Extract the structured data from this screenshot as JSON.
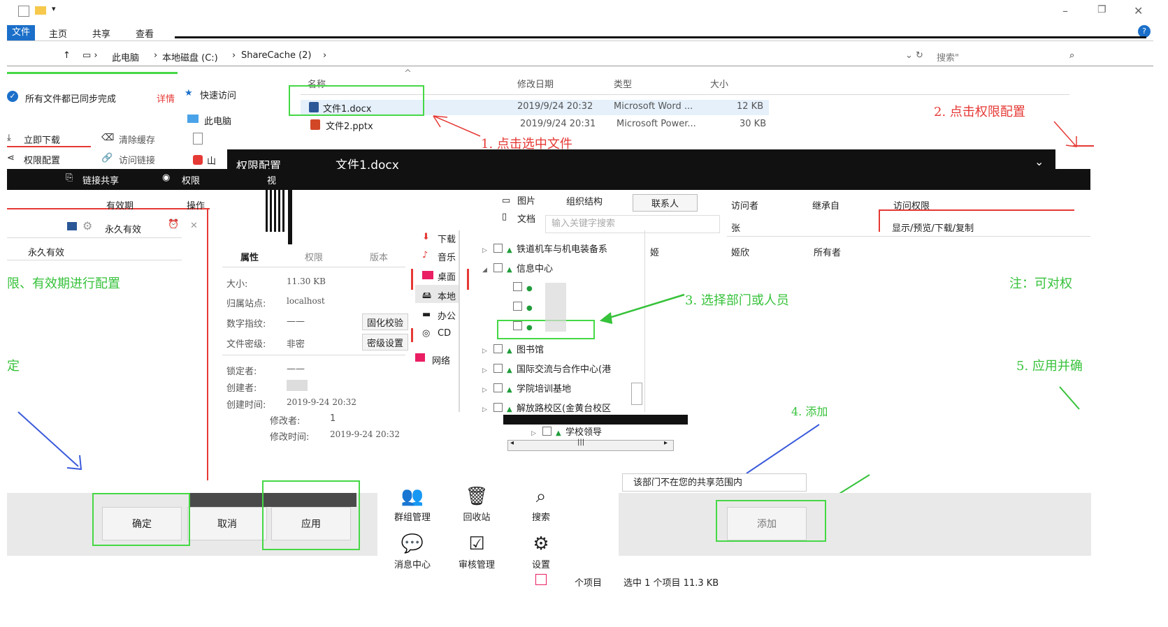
{
  "quick_access": {
    "icons": [
      "checkbox-icon",
      "folder-icon",
      "dropdown-arrow-icon"
    ]
  },
  "window_controls": {
    "minimize": "–",
    "restore": "❐",
    "close": "✕"
  },
  "ribbon": {
    "tabs": [
      "文件",
      "主页",
      "共享",
      "查看"
    ],
    "active_tab": "文件"
  },
  "address": {
    "path": [
      "此电脑",
      "本地磁盘 (C:)",
      "ShareCache (2)"
    ],
    "search_placeholder": "搜索\""
  },
  "sync": {
    "status": "所有文件都已同步完成",
    "details_link": "详情"
  },
  "actions": {
    "download": "立即下载",
    "clear_cache": "清除缓存",
    "permission_config": "权限配置",
    "access_link": "访问链接",
    "link_share": "链接共享",
    "permission_label": "权限",
    "view": "视"
  },
  "nav": {
    "quick_access": "快速访问",
    "this_pc": "此电脑",
    "shan": "山",
    "pictures": "图片",
    "documents": "文档"
  },
  "file_list": {
    "columns": [
      "名称",
      "修改日期",
      "类型",
      "大小"
    ],
    "files": [
      {
        "name": "文件1.docx",
        "date": "2019/9/24 20:32",
        "type": "Microsoft Word ...",
        "size": "12 KB"
      },
      {
        "name": "文件2.pptx",
        "date": "2019/9/24 20:31",
        "type": "Microsoft Power...",
        "size": "30 KB"
      }
    ]
  },
  "annotations": {
    "step1": "1. 点击选中文件",
    "step2": "2. 点击权限配置",
    "step3": "3. 选择部门或人员",
    "step4": "4. 添加",
    "step5": "5. 应用并确",
    "note_left": "限、有效期进行配置",
    "note_right": "注：可对权",
    "ding": "定"
  },
  "dialog": {
    "title": "权限配置",
    "file": "文件1.docx",
    "collapse": "⌄"
  },
  "expiry": {
    "col_validity": "有效期",
    "col_action": "操作",
    "row_value": "永久有效",
    "list_item": "永久有效"
  },
  "props": {
    "tabs": [
      "属性",
      "权限",
      "版本"
    ],
    "size_label": "大小:",
    "size": "11.30 KB",
    "site_label": "归属站点:",
    "site": "localhost",
    "digital_label": "数字指纹:",
    "digital": "——",
    "secret_label": "文件密级:",
    "secret": "非密",
    "btn_verify": "固化校验",
    "btn_secret": "密级设置",
    "locker_label": "锁定者:",
    "locker": "——",
    "creator_label": "创建者:",
    "created_label": "创建时间:",
    "created": "2019-9-24 20:32",
    "modifier_label": "修改者:",
    "modifier": "1",
    "modified_label": "修改时间:",
    "modified": "2019-9-24 20:32"
  },
  "sidebar_nav": [
    "下载",
    "音乐",
    "桌面",
    "本地",
    "办公",
    "CD",
    "网络"
  ],
  "org": {
    "tabs": [
      "组织结构",
      "联系人"
    ],
    "search_placeholder": "输入关键字搜索",
    "tree": [
      "铁道机车与机电装备系",
      "信息中心",
      "",
      "",
      "",
      "图书馆",
      "国际交流与合作中心(港",
      "学院培训基地",
      "解放路校区(金黄台校区",
      "学校领导"
    ]
  },
  "access": {
    "columns": [
      "访问者",
      "继承自",
      "访问权限"
    ],
    "perm_value": "显示/预览/下载/复制",
    "visitor": "张",
    "row2": [
      "姬",
      "姬欣",
      "所有者"
    ]
  },
  "warning": "该部门不在您的共享范围内",
  "buttons": {
    "ok": "确定",
    "cancel": "取消",
    "apply": "应用",
    "add": "添加"
  },
  "tools": [
    {
      "label": "群组管理",
      "icon": "group-icon"
    },
    {
      "label": "回收站",
      "icon": "trash-icon"
    },
    {
      "label": "搜索",
      "icon": "search-icon"
    },
    {
      "label": "消息中心",
      "icon": "message-icon"
    },
    {
      "label": "审核管理",
      "icon": "audit-icon"
    },
    {
      "label": "设置",
      "icon": "gear-icon"
    }
  ],
  "status_bar": {
    "count": "个项目",
    "selected": "选中 1 个项目  11.3 KB"
  },
  "colors": {
    "annotation_red": "#e53935",
    "highlight_green": "#45d845",
    "tree_green": "#1f9c3a"
  }
}
